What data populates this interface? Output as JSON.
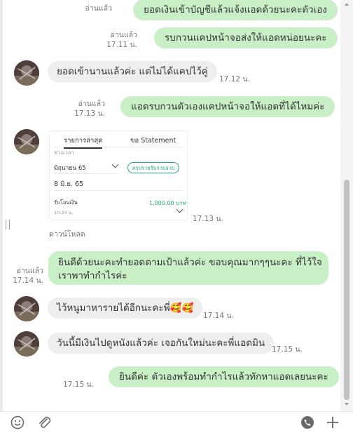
{
  "messages": {
    "m1": {
      "text": "ยอดเงินเข้าบัญชีแล้วแจ้งแอดด้วยนะคะตัวเอง",
      "read": "อ่านแล้ว"
    },
    "m2": {
      "text": "รบกวนแคปหน้าจอส่งให้แอดหน่อยนะคะ",
      "read": "อ่านแล้ว",
      "time": "17.11 น."
    },
    "m3": {
      "text": "ยอดเข้านานแล้วค่ะ แต่ไม่ได้แคปไว้คู่",
      "time": "17.12 น."
    },
    "m4": {
      "text": "แอดรบกวนตัวเองแคปหน้าจอให้แอดที่ได้ไหมค่ะ",
      "read": "อ่านแล้ว",
      "time": "17.13 น."
    },
    "m5": {
      "time": "17.13 น.",
      "download": "ดาวน์โหลด"
    },
    "m6": {
      "line1": "ยินดีด้วยนะคะทำยอดตามเป้าแล้วค่ะ  ขอบคุณมากๆๆนะคะ  ที่ไว้ใจ",
      "line2": "เราพาทำกำไรค่ะ",
      "read": "อ่านแล้ว",
      "time": "17.14 น."
    },
    "m7": {
      "text": "ไว้หนูมาหารายได้อีกนะคะพี่",
      "emoji": "🥰🥰",
      "time": "17.14 น."
    },
    "m8": {
      "text": "วันนี้มีเงินไปดูหนังแล้วค่ะ เจอกันใหม่นะคะพี่แอดมิน",
      "time": "17.15 น."
    },
    "m9": {
      "text": "ยินดีค่ะ ตัวเองพร้อมทำกำไรแล้วทักหาแอดเลยนะคะ",
      "time": "17.15 น."
    }
  },
  "statement_image": {
    "tab_active": "รายการล่าสุด",
    "tab_other": "ขอ Statement",
    "period_label": "ช่วงเวลา",
    "month": "มิถุนายน 65",
    "summary_button": "สรุปรายรับรายจ่าย",
    "date": "8 มิ.ย. 65",
    "tx_label": "รับโอนเงิน",
    "tx_amount": "1,000.00 บาท",
    "tx_time": "10:24 น."
  },
  "icons": [
    "emoji-icon",
    "attach-icon",
    "voice-call-icon",
    "plus-icon"
  ],
  "colors": {
    "outgoing_bubble": "#c9efc7",
    "incoming_bubble": "#eeeeee",
    "accent": "#1ea87a"
  }
}
